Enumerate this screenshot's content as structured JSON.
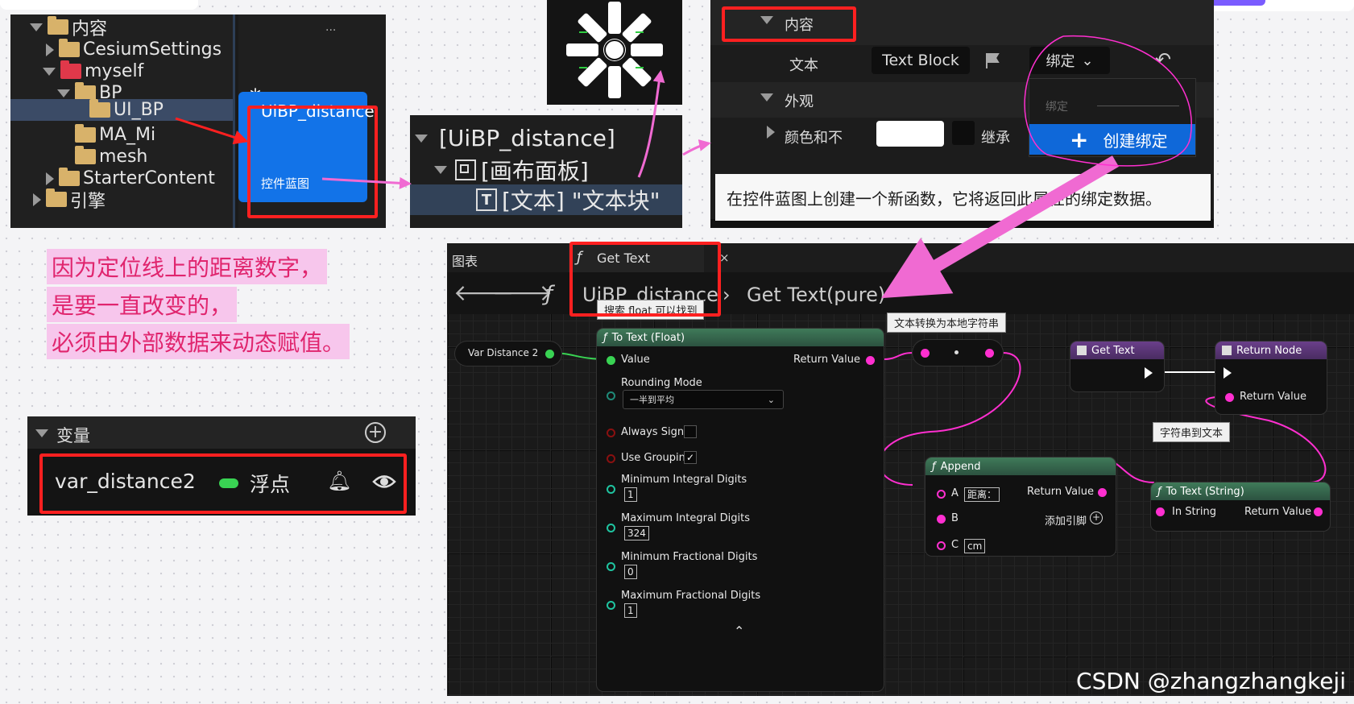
{
  "content_browser": {
    "items": [
      {
        "label": "内容"
      },
      {
        "label": "CesiumSettings"
      },
      {
        "label": "myself"
      },
      {
        "label": "BP"
      },
      {
        "label": "UI_BP"
      },
      {
        "label": "MA_Mi"
      },
      {
        "label": "mesh"
      },
      {
        "label": "StarterContent"
      },
      {
        "label": "引擎"
      }
    ],
    "asset": {
      "name": "UiBP_distance",
      "type": "控件蓝图"
    },
    "more_glyph": "..."
  },
  "hierarchy": {
    "root": "[UiBP_distance]",
    "canvas": "[画布面板]",
    "text": "[文本] \"文本块\"",
    "text_icon": "T"
  },
  "details": {
    "section_content": "内容",
    "text_label": "文本",
    "text_value": "Text Block",
    "bind_button": "绑定",
    "section_appearance": "外观",
    "color_label": "颜色和不",
    "inherit_label": "继承",
    "bind_menu_header": "绑定",
    "create_binding": "创建绑定",
    "tooltip": "在控件蓝图上创建一个新函数，它将返回此属性的绑定数据。"
  },
  "note": {
    "line1": "因为定位线上的距离数字，",
    "line2": "是要一直改变的，",
    "line3": "必须由外部数据来动态赋值。"
  },
  "variables": {
    "header": "变量",
    "name": "var_distance2",
    "type": "浮点"
  },
  "graph": {
    "tab_graph": "图表",
    "tab_func": "Get Text",
    "tab_close": "×",
    "breadcrumb_bp": "UiBP_distance",
    "breadcrumb_func": "Get Text(pure)",
    "comments": {
      "search": "搜索 float 可以找到",
      "to_local": "文本转换为本地字符串",
      "str_to_text": "字符串到文本"
    },
    "var_node": "Var Distance 2",
    "to_text_float": {
      "title": "To Text (Float)",
      "value": "Value",
      "return": "Return Value",
      "rounding": "Rounding Mode",
      "rounding_value": "一半到平均",
      "always_sign": "Always Sign",
      "use_grouping": "Use Grouping",
      "min_int": "Minimum Integral Digits",
      "min_int_v": "1",
      "max_int": "Maximum Integral Digits",
      "max_int_v": "324",
      "min_frac": "Minimum Fractional Digits",
      "min_frac_v": "0",
      "max_frac": "Maximum Fractional Digits",
      "max_frac_v": "1"
    },
    "get_text": "Get Text",
    "return_node": "Return Node",
    "return_value": "Return Value",
    "append": {
      "title": "Append",
      "a": "A",
      "a_v": "距离：",
      "b": "B",
      "c": "C",
      "c_v": "cm",
      "return": "Return Value",
      "add_pin": "添加引脚"
    },
    "to_text_string": {
      "title": "To Text (String)",
      "in": "In String",
      "return": "Return Value"
    }
  },
  "watermark": "CSDN @zhangzhangkeji",
  "colors": {
    "annotation": "#ff2020",
    "arrow": "#f06ad2",
    "pin_float": "#39d353",
    "pin_text": "#ff2fd0",
    "accent_blue": "#1273e8"
  }
}
